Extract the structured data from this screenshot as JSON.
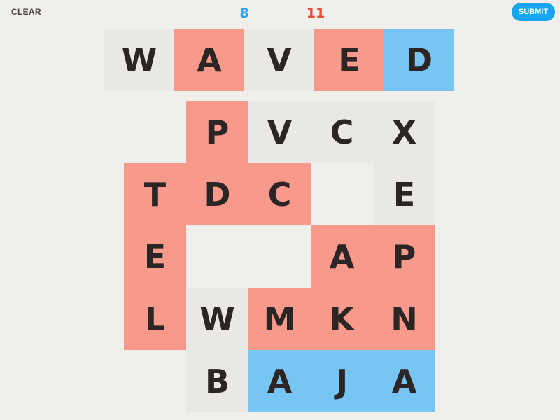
{
  "controls": {
    "clear_label": "CLEAR",
    "submit_label": "SUBMIT"
  },
  "scores": {
    "blue": "8",
    "red": "11"
  },
  "colors": {
    "background": "#f0efeb",
    "neutral": "#e9e8e5",
    "red": "#f79a8b",
    "blue": "#77c5f2",
    "blue_text": "#2aa4ee",
    "red_text": "#f04e36",
    "submit_bg": "#17a5f0"
  },
  "current_word": [
    {
      "letter": "W",
      "owner": "neutral"
    },
    {
      "letter": "A",
      "owner": "red"
    },
    {
      "letter": "V",
      "owner": "neutral"
    },
    {
      "letter": "E",
      "owner": "red"
    },
    {
      "letter": "D",
      "owner": "blue"
    }
  ],
  "board": {
    "rows": [
      [
        null,
        null,
        {
          "letter": "P",
          "owner": "red"
        },
        {
          "letter": "V",
          "owner": "neutral"
        },
        {
          "letter": "C",
          "owner": "neutral"
        },
        {
          "letter": "X",
          "owner": "neutral"
        }
      ],
      [
        null,
        {
          "letter": "T",
          "owner": "red"
        },
        {
          "letter": "D",
          "owner": "red"
        },
        {
          "letter": "C",
          "owner": "red"
        },
        null,
        {
          "letter": "E",
          "owner": "neutral"
        }
      ],
      [
        null,
        {
          "letter": "E",
          "owner": "red"
        },
        null,
        null,
        {
          "letter": "A",
          "owner": "red"
        },
        {
          "letter": "P",
          "owner": "red"
        }
      ],
      [
        null,
        {
          "letter": "L",
          "owner": "red"
        },
        {
          "letter": "W",
          "owner": "neutral"
        },
        {
          "letter": "M",
          "owner": "red"
        },
        {
          "letter": "K",
          "owner": "red"
        },
        {
          "letter": "N",
          "owner": "red"
        }
      ],
      [
        null,
        null,
        {
          "letter": "B",
          "owner": "neutral"
        },
        {
          "letter": "A",
          "owner": "blue"
        },
        {
          "letter": "J",
          "owner": "blue"
        },
        {
          "letter": "A",
          "owner": "blue"
        }
      ]
    ]
  }
}
